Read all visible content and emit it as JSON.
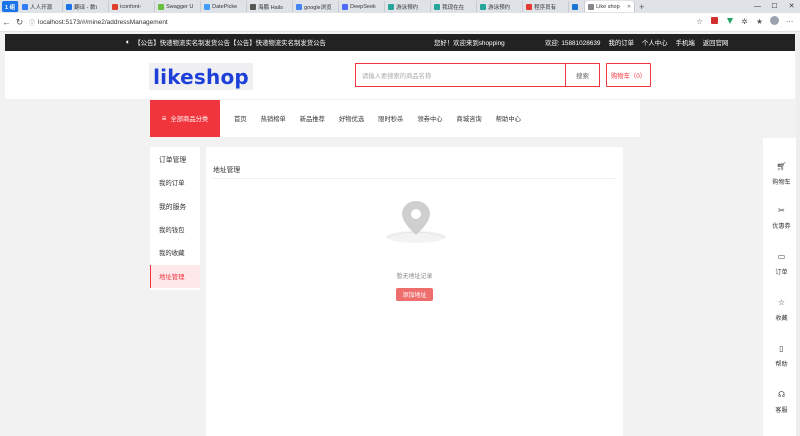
{
  "browser": {
    "tabs": [
      {
        "label": "1 组",
        "type": "num"
      },
      {
        "label": "人人开源",
        "color": "#2f7cf6"
      },
      {
        "label": "翻译 - 数ì",
        "color": "#1a73e8"
      },
      {
        "label": "iconfont-",
        "color": "#e03e2d"
      },
      {
        "label": "Swagger U",
        "color": "#6abf40"
      },
      {
        "label": "DatePicke",
        "color": "#409eff"
      },
      {
        "label": "海鹏 Hails",
        "color": "#555555"
      },
      {
        "label": "google浏览",
        "color": "#4285f4"
      },
      {
        "label": "DeepSeek",
        "color": "#4d6bfe"
      },
      {
        "label": "游泳预约",
        "color": "#26a69a"
      },
      {
        "label": "我现在在",
        "color": "#26a69a"
      },
      {
        "label": "游泳预约",
        "color": "#26a69a"
      },
      {
        "label": "程序员有",
        "color": "#e53935"
      },
      {
        "label": "",
        "color": "#1976d2"
      },
      {
        "label": "Like shop",
        "color": "#888888",
        "active": true
      }
    ],
    "new_tab": "+",
    "window_controls": [
      "—",
      "☐",
      "✕"
    ],
    "url": "localhost:5173/#/mine2/addressManagement"
  },
  "topbar": {
    "notice": "【公告】快递物流实名制发货公告【公告】快递物流实名制发货公告",
    "welcome": "您好！欢迎来到shopping",
    "links": [
      "欢迎: 15881028639",
      "我的订单",
      "个人中心",
      "手机端",
      "返回官网"
    ]
  },
  "header": {
    "logo": "likeshop",
    "search_placeholder": "请输入要搜索的商品名称",
    "search_button": "搜索",
    "cart": "购物车（0）"
  },
  "nav": {
    "category_button": "全部商品分类",
    "links": [
      "首页",
      "热销榜单",
      "新品推荐",
      "好物优选",
      "限时秒杀",
      "领券中心",
      "商城咨询",
      "帮助中心"
    ]
  },
  "menu": {
    "items": [
      "订单管理",
      "我的订单",
      "我的服务",
      "我的钱包",
      "我的收藏",
      "地址管理"
    ],
    "active_index": 5
  },
  "content": {
    "title": "地址管理",
    "empty_text": "暂无地址记录",
    "add_button": "添加地址"
  },
  "right_bar": [
    {
      "label": "购物车",
      "icon": "cart-icon"
    },
    {
      "label": "优惠券",
      "icon": "coupon-icon"
    },
    {
      "label": "订单",
      "icon": "order-icon"
    },
    {
      "label": "收藏",
      "icon": "star-icon"
    },
    {
      "label": "帮助",
      "icon": "help-icon"
    },
    {
      "label": "客服",
      "icon": "headset-icon"
    }
  ],
  "colors": {
    "accent": "#f0353d",
    "topbar": "#222222",
    "add_button": "#ee6e6e",
    "logo": "#1e40d8"
  }
}
